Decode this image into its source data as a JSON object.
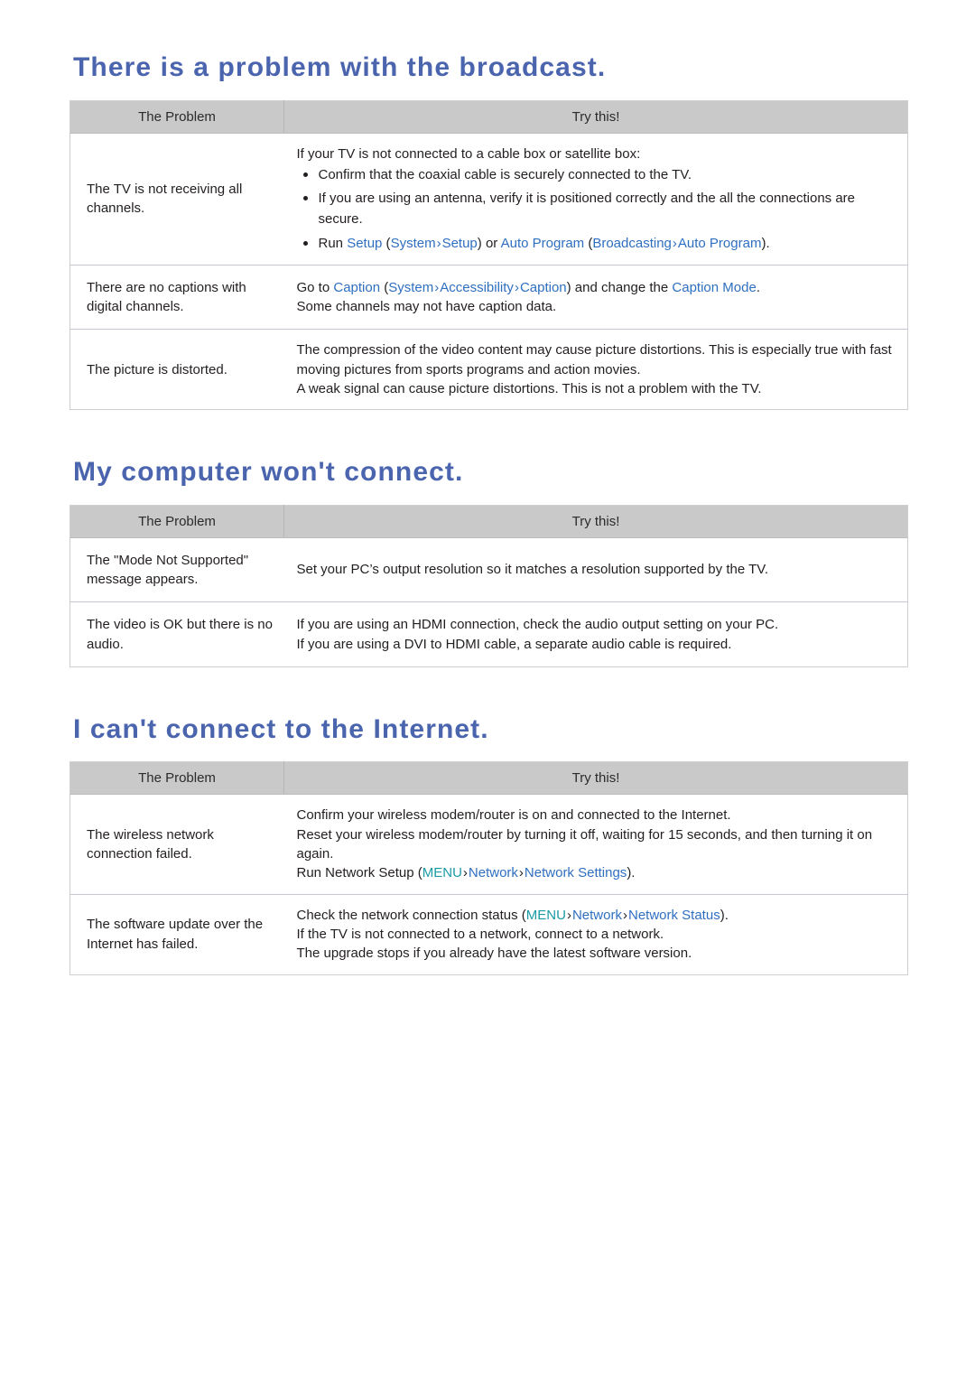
{
  "document": {
    "type": "tv-troubleshooting-guide",
    "heading_color": "#4a64ae",
    "menu_link_color": "#2f6fc0",
    "menu_key_color": "#1a9aa3",
    "header_bg_color": "#c9c9c9"
  },
  "columns": {
    "problem": "The Problem",
    "try_this": "Try this!"
  },
  "sections": [
    {
      "id": "broadcast",
      "heading": "There is a problem with the broadcast.",
      "rows": [
        {
          "problem": "The TV is not receiving all channels.",
          "intro": "If your TV is not connected to a cable box or satellite box:",
          "bullets": [
            {
              "parts": [
                {
                  "text": "Confirm that the coaxial cable is securely connected to the TV.",
                  "style": "plain"
                }
              ]
            },
            {
              "parts": [
                {
                  "text": "If you are using an antenna, verify it is positioned correctly and the all the connections are secure.",
                  "style": "plain"
                }
              ]
            },
            {
              "parts": [
                {
                  "text": "Run ",
                  "style": "plain"
                },
                {
                  "text": "Setup",
                  "style": "link"
                },
                {
                  "text": " (",
                  "style": "plain"
                },
                {
                  "text": "System",
                  "style": "link"
                },
                {
                  "text": "›",
                  "style": "arrow"
                },
                {
                  "text": "Setup",
                  "style": "link"
                },
                {
                  "text": ") or ",
                  "style": "plain"
                },
                {
                  "text": "Auto Program",
                  "style": "link"
                },
                {
                  "text": " (",
                  "style": "plain"
                },
                {
                  "text": "Broadcasting",
                  "style": "link"
                },
                {
                  "text": "›",
                  "style": "arrow"
                },
                {
                  "text": "Auto Program",
                  "style": "link"
                },
                {
                  "text": ").",
                  "style": "plain"
                }
              ]
            }
          ]
        },
        {
          "problem": "There are no captions with digital channels.",
          "lines": [
            {
              "parts": [
                {
                  "text": "Go to ",
                  "style": "plain"
                },
                {
                  "text": "Caption",
                  "style": "link"
                },
                {
                  "text": " (",
                  "style": "plain"
                },
                {
                  "text": "System",
                  "style": "link"
                },
                {
                  "text": "›",
                  "style": "arrow"
                },
                {
                  "text": "Accessibility",
                  "style": "link"
                },
                {
                  "text": "›",
                  "style": "arrow"
                },
                {
                  "text": "Caption",
                  "style": "link"
                },
                {
                  "text": ") and change the ",
                  "style": "plain"
                },
                {
                  "text": "Caption Mode",
                  "style": "link"
                },
                {
                  "text": ".",
                  "style": "plain"
                }
              ]
            },
            {
              "parts": [
                {
                  "text": "Some channels may not have caption data.",
                  "style": "plain"
                }
              ]
            }
          ]
        },
        {
          "problem": "The picture is distorted.",
          "lines": [
            {
              "parts": [
                {
                  "text": "The compression of the video content may cause picture distortions. This is especially true with fast moving pictures from sports programs and action movies.",
                  "style": "plain"
                }
              ]
            },
            {
              "parts": [
                {
                  "text": "A weak signal can cause picture distortions. This is not a problem with the TV.",
                  "style": "plain"
                }
              ]
            }
          ]
        }
      ]
    },
    {
      "id": "computer",
      "heading": "My computer won't connect.",
      "rows": [
        {
          "problem": "The \"Mode Not Supported\" message appears.",
          "lines": [
            {
              "parts": [
                {
                  "text": "Set your PC’s output resolution so it matches a resolution supported by the TV.",
                  "style": "plain"
                }
              ]
            }
          ]
        },
        {
          "problem": "The video is OK but there is no audio.",
          "lines": [
            {
              "parts": [
                {
                  "text": "If you are using an HDMI connection, check the audio output setting on your PC.",
                  "style": "plain"
                }
              ]
            },
            {
              "parts": [
                {
                  "text": "If you are using a DVI to HDMI cable, a separate audio cable is required.",
                  "style": "plain"
                }
              ]
            }
          ]
        }
      ]
    },
    {
      "id": "internet",
      "heading": "I can't connect to the Internet.",
      "rows": [
        {
          "problem": "The wireless network connection failed.",
          "lines": [
            {
              "parts": [
                {
                  "text": "Confirm your wireless modem/router is on and connected to the Internet.",
                  "style": "plain"
                }
              ]
            },
            {
              "parts": [
                {
                  "text": "Reset your wireless modem/router by turning it off, waiting for 15 seconds, and then turning it on again.",
                  "style": "plain"
                }
              ]
            },
            {
              "parts": [
                {
                  "text": "Run Network Setup (",
                  "style": "plain"
                },
                {
                  "text": "MENU",
                  "style": "key"
                },
                {
                  "text": "›",
                  "style": "arrow-dark"
                },
                {
                  "text": "Network",
                  "style": "link"
                },
                {
                  "text": "›",
                  "style": "arrow-dark"
                },
                {
                  "text": "Network Settings",
                  "style": "link"
                },
                {
                  "text": ").",
                  "style": "plain"
                }
              ]
            }
          ]
        },
        {
          "problem": "The software update over the Internet has failed.",
          "lines": [
            {
              "parts": [
                {
                  "text": "Check the network connection status (",
                  "style": "plain"
                },
                {
                  "text": "MENU",
                  "style": "key"
                },
                {
                  "text": "›",
                  "style": "arrow-dark"
                },
                {
                  "text": "Network",
                  "style": "link"
                },
                {
                  "text": "›",
                  "style": "arrow-dark"
                },
                {
                  "text": "Network Status",
                  "style": "link"
                },
                {
                  "text": ").",
                  "style": "plain"
                }
              ]
            },
            {
              "parts": [
                {
                  "text": "If the TV is not connected to a network, connect to a network.",
                  "style": "plain"
                }
              ]
            },
            {
              "parts": [
                {
                  "text": "The upgrade stops if you already have the latest software version.",
                  "style": "plain"
                }
              ]
            }
          ]
        }
      ]
    }
  ]
}
